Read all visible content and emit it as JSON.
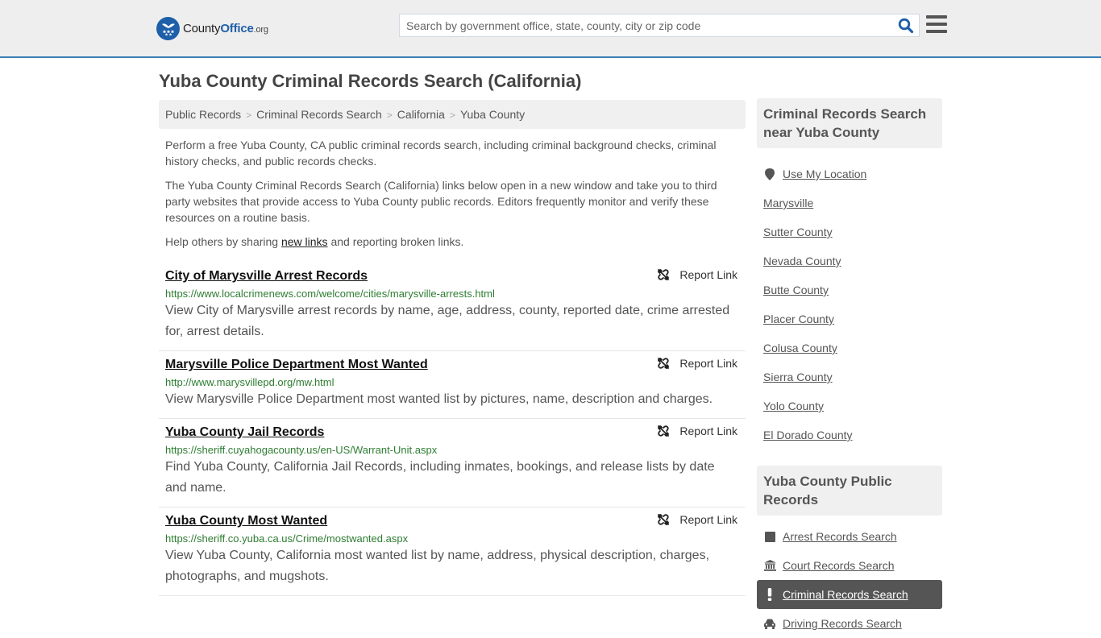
{
  "header": {
    "logo": {
      "name_part1": "County",
      "name_part2": "Office",
      "suffix": ".org"
    },
    "search": {
      "placeholder": "Search by government office, state, county, city or zip code",
      "value": ""
    },
    "icons": {
      "search": "search-icon",
      "menu": "hamburger-menu-icon"
    }
  },
  "colors": {
    "brand_blue": "#1d5fa8",
    "header_border": "#3a7db5",
    "url_green": "#2e7d32",
    "active_bg": "#555555"
  },
  "main": {
    "title": "Yuba County Criminal Records Search (California)",
    "breadcrumb": [
      "Public Records",
      "Criminal Records Search",
      "California",
      "Yuba County"
    ],
    "breadcrumb_separator": ">",
    "intro": {
      "p1": "Perform a free Yuba County, CA public criminal records search, including criminal background checks, criminal history checks, and public records checks.",
      "p2": "The Yuba County Criminal Records Search (California) links below open in a new window and take you to third party websites that provide access to Yuba County public records. Editors frequently monitor and verify these resources on a routine basis.",
      "p3_before": "Help others by sharing ",
      "p3_link": "new links",
      "p3_after": " and reporting broken links."
    },
    "report_label": "Report Link",
    "results": [
      {
        "title": "City of Marysville Arrest Records",
        "url": "https://www.localcrimenews.com/welcome/cities/marysville-arrests.html",
        "description": "View City of Marysville arrest records by name, age, address, county, reported date, crime arrested for, arrest details."
      },
      {
        "title": "Marysville Police Department Most Wanted",
        "url": "http://www.marysvillepd.org/mw.html",
        "description": "View Marysville Police Department most wanted list by pictures, name, description and charges."
      },
      {
        "title": "Yuba County Jail Records",
        "url": "https://sheriff.cuyahogacounty.us/en-US/Warrant-Unit.aspx",
        "description": "Find Yuba County, California Jail Records, including inmates, bookings, and release lists by date and name."
      },
      {
        "title": "Yuba County Most Wanted",
        "url": "https://sheriff.co.yuba.ca.us/Crime/mostwanted.aspx",
        "description": "View Yuba County, California most wanted list by name, address, physical description, charges, photographs, and mugshots."
      }
    ]
  },
  "sidebar": {
    "nearby_heading": "Criminal Records Search near Yuba County",
    "use_location": "Use My Location",
    "nearby": [
      "Marysville",
      "Sutter County",
      "Nevada County",
      "Butte County",
      "Placer County",
      "Colusa County",
      "Sierra County",
      "Yolo County",
      "El Dorado County"
    ],
    "public_records_heading": "Yuba County Public Records",
    "public_records": [
      {
        "label": "Arrest Records Search",
        "icon": "square-icon",
        "active": false
      },
      {
        "label": "Court Records Search",
        "icon": "courthouse-icon",
        "active": false
      },
      {
        "label": "Criminal Records Search",
        "icon": "exclamation-icon",
        "active": true
      },
      {
        "label": "Driving Records Search",
        "icon": "car-icon",
        "active": false
      }
    ]
  }
}
